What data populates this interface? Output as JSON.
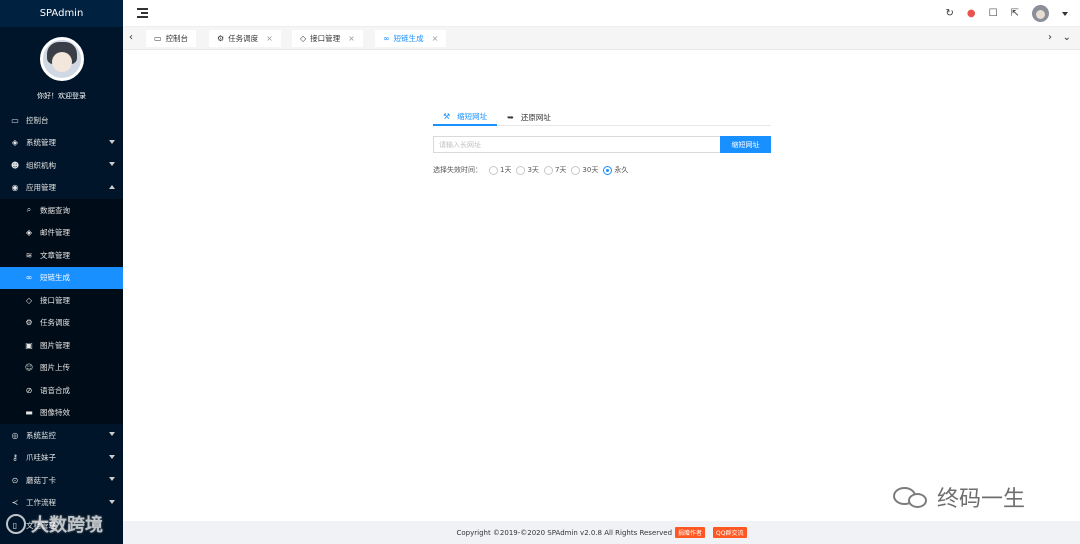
{
  "app": {
    "brand": "SPAdmin",
    "welcome": "你好！欢迎登录"
  },
  "sidebar": {
    "items": [
      {
        "label": "控制台",
        "icon": "monitor-icon",
        "glyph": "▭",
        "expandable": false
      },
      {
        "label": "系统管理",
        "icon": "layers-icon",
        "glyph": "◈",
        "expandable": true
      },
      {
        "label": "组织机构",
        "icon": "users-icon",
        "glyph": "👥",
        "expandable": true
      },
      {
        "label": "应用管理",
        "icon": "apps-icon",
        "glyph": "◉",
        "expandable": true,
        "expanded": true
      }
    ],
    "subitems": [
      {
        "label": "数据查询",
        "icon": "search-icon",
        "glyph": "⌕"
      },
      {
        "label": "邮件管理",
        "icon": "mail-stack-icon",
        "glyph": "◈"
      },
      {
        "label": "文章管理",
        "icon": "article-icon",
        "glyph": "≋"
      },
      {
        "label": "短链生成",
        "icon": "link-icon",
        "glyph": "∞",
        "active": true
      },
      {
        "label": "接口管理",
        "icon": "shield-check-icon",
        "glyph": "◇"
      },
      {
        "label": "任务调度",
        "icon": "gear-icon",
        "glyph": "⚙"
      },
      {
        "label": "图片管理",
        "icon": "image-icon",
        "glyph": "▣"
      },
      {
        "label": "图片上传",
        "icon": "smile-upload-icon",
        "glyph": "☺"
      },
      {
        "label": "语音合成",
        "icon": "voice-icon",
        "glyph": "⊘"
      },
      {
        "label": "图像特效",
        "icon": "effects-icon",
        "glyph": "▬"
      }
    ],
    "bottom_items": [
      {
        "label": "系统监控",
        "icon": "camera-icon",
        "glyph": "◎",
        "expandable": true
      },
      {
        "label": "爪哇妹子",
        "icon": "key-icon",
        "glyph": "⚷",
        "expandable": true
      },
      {
        "label": "蘑菇丁卡",
        "icon": "location-icon",
        "glyph": "⊙",
        "expandable": true
      },
      {
        "label": "工作流程",
        "icon": "share-icon",
        "glyph": "≺",
        "expandable": true
      },
      {
        "label": "文档管理",
        "icon": "doc-icon",
        "glyph": "▯",
        "expandable": false
      }
    ]
  },
  "tabs": [
    {
      "label": "控制台",
      "icon": "monitor-icon",
      "glyph": "▭",
      "closable": false
    },
    {
      "label": "任务调度",
      "icon": "gear-icon",
      "glyph": "⚙",
      "closable": true
    },
    {
      "label": "接口管理",
      "icon": "shield-check-icon",
      "glyph": "◇",
      "closable": true
    },
    {
      "label": "短链生成",
      "icon": "link-icon",
      "glyph": "∞",
      "closable": true,
      "active": true
    }
  ],
  "shortlink": {
    "tab_shorten": "缩短网址",
    "tab_restore": "还原网址",
    "input_placeholder": "请输入长网址",
    "button": "缩短网址",
    "expire_label": "选择失效时间：",
    "expire_options": [
      "1天",
      "3天",
      "7天",
      "30天",
      "永久"
    ],
    "expire_selected": "永久"
  },
  "footer": {
    "copyright": "Copyright ©2019-©2020 SPAdmin v2.0.8 All Rights Reserved",
    "badge1": "捐赠作者",
    "badge2": "QQ群交流"
  },
  "watermarks": {
    "right": "终码一生",
    "left": "大数跨境"
  },
  "colors": {
    "sidebar_bg": "#001529",
    "accent": "#1890ff",
    "badge": "#ff5722",
    "footer_bg": "#f0f2f5"
  }
}
